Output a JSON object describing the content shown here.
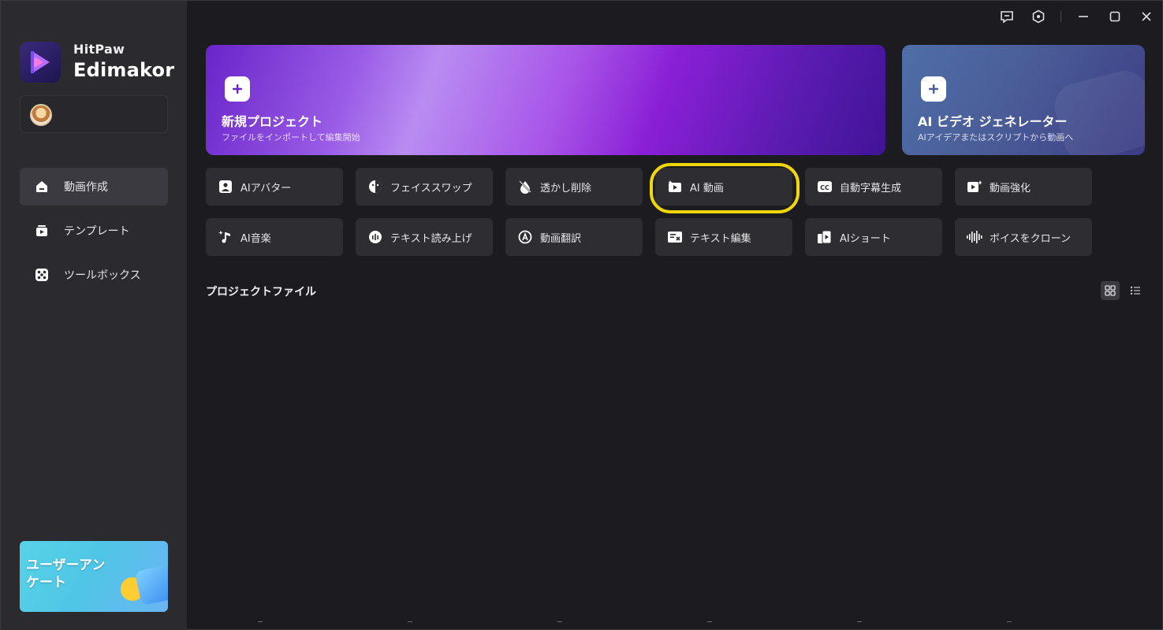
{
  "brand": {
    "top": "HitPaw",
    "bottom": "Edimakor"
  },
  "sidebar": {
    "items": [
      {
        "label": "動画作成",
        "icon": "home-icon",
        "active": true
      },
      {
        "label": "テンプレート",
        "icon": "template-icon",
        "active": false
      },
      {
        "label": "ツールボックス",
        "icon": "toolbox-icon",
        "active": false
      }
    ],
    "banner": {
      "text": "ユーザーアンケート"
    }
  },
  "hero": {
    "new_project": {
      "title": "新規プロジェクト",
      "subtitle": "ファイルをインポートして編集開始"
    },
    "ai_video": {
      "title": "AI ビデオ ジェネレーター",
      "subtitle": "AIアイデアまたはスクリプトから動画へ"
    }
  },
  "tools": {
    "row1": [
      {
        "label": "AIアバター",
        "icon": "avatar-icon"
      },
      {
        "label": "フェイススワップ",
        "icon": "face-swap-icon"
      },
      {
        "label": "透かし削除",
        "icon": "watermark-remove-icon"
      },
      {
        "label": "AI 動画",
        "icon": "ai-video-icon"
      },
      {
        "label": "自動字幕生成",
        "icon": "cc-icon"
      },
      {
        "label": "動画強化",
        "icon": "enhance-icon"
      }
    ],
    "row2": [
      {
        "label": "AI音楽",
        "icon": "music-icon"
      },
      {
        "label": "テキスト読み上げ",
        "icon": "tts-icon"
      },
      {
        "label": "動画翻訳",
        "icon": "translate-icon"
      },
      {
        "label": "テキスト編集",
        "icon": "text-edit-icon"
      },
      {
        "label": "AIショート",
        "icon": "ai-short-icon"
      },
      {
        "label": "ボイスをクローン",
        "icon": "voice-clone-icon"
      }
    ]
  },
  "project_files": {
    "title": "プロジェクトファイル"
  },
  "colors": {
    "highlight": "#f2d60c",
    "sidebar": "#2b2b2f",
    "background": "#1c1b20",
    "tool_bg": "#2d2d32"
  }
}
